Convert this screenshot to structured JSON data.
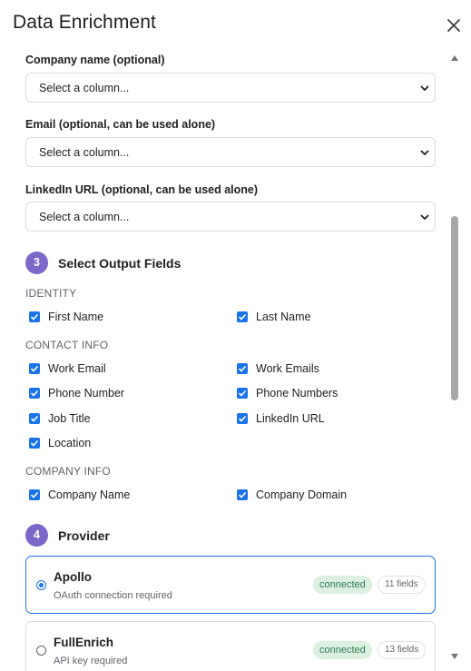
{
  "header": {
    "title": "Data Enrichment",
    "close_icon": "close-icon"
  },
  "inputs": {
    "company": {
      "label": "Company name (optional)",
      "value": "Select a column..."
    },
    "email": {
      "label": "Email (optional, can be used alone)",
      "value": "Select a column..."
    },
    "linkedin": {
      "label": "LinkedIn URL (optional, can be used alone)",
      "value": "Select a column..."
    }
  },
  "output": {
    "step": "3",
    "title": "Select Output Fields",
    "identity": {
      "label": "IDENTITY",
      "fields": [
        {
          "label": "First Name",
          "checked": true
        },
        {
          "label": "Last Name",
          "checked": true
        }
      ]
    },
    "contact": {
      "label": "CONTACT INFO",
      "fields": [
        {
          "label": "Work Email",
          "checked": true
        },
        {
          "label": "Work Emails",
          "checked": true
        },
        {
          "label": "Phone Number",
          "checked": true
        },
        {
          "label": "Phone Numbers",
          "checked": true
        },
        {
          "label": "Job Title",
          "checked": true
        },
        {
          "label": "LinkedIn URL",
          "checked": true
        },
        {
          "label": "Location",
          "checked": true
        }
      ]
    },
    "company": {
      "label": "COMPANY INFO",
      "fields": [
        {
          "label": "Company Name",
          "checked": true
        },
        {
          "label": "Company Domain",
          "checked": true
        }
      ]
    }
  },
  "provider": {
    "step": "4",
    "title": "Provider",
    "options": [
      {
        "name": "Apollo",
        "subtitle": "OAuth connection required",
        "status": "connected",
        "fields": "11 fields",
        "selected": true
      },
      {
        "name": "FullEnrich",
        "subtitle": "API key required",
        "status": "connected",
        "fields": "13 fields",
        "selected": false
      }
    ]
  },
  "colors": {
    "accent": "#1a73e8",
    "step_badge": "#7b68c9",
    "connected_bg": "#dcefe0",
    "connected_text": "#2e7d4f"
  }
}
